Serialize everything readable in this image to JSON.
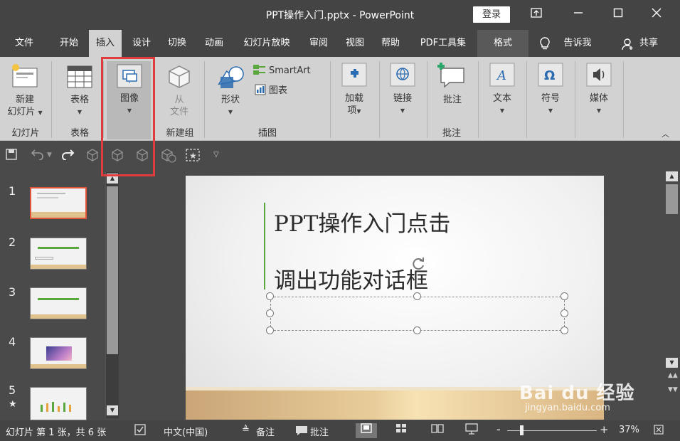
{
  "window": {
    "title": "PPT操作入门.pptx  -  PowerPoint",
    "login_label": "登录",
    "controls": [
      "ribbon-display-icon",
      "minimize-icon",
      "maximize-icon",
      "close-icon"
    ]
  },
  "tabs": [
    {
      "label": "文件"
    },
    {
      "label": "开始"
    },
    {
      "label": "插入",
      "active": true
    },
    {
      "label": "设计"
    },
    {
      "label": "切换"
    },
    {
      "label": "动画"
    },
    {
      "label": "幻灯片放映"
    },
    {
      "label": "审阅"
    },
    {
      "label": "视图"
    },
    {
      "label": "帮助"
    },
    {
      "label": "PDF工具集"
    },
    {
      "label": "格式"
    }
  ],
  "tell_me": "告诉我",
  "share": "共享",
  "ribbon": {
    "new_slide": [
      "新建",
      "幻灯片"
    ],
    "table": "表格",
    "images": "图像",
    "from_file": [
      "从",
      "文件"
    ],
    "shapes": "形状",
    "smartart": "SmartArt",
    "chart": "图表",
    "addins": [
      "加载",
      "项"
    ],
    "links": "链接",
    "comment": "批注",
    "text": "文本",
    "symbols": "符号",
    "media": "媒体",
    "groups": {
      "slides": "幻灯片",
      "tables": "表格",
      "new_group": "新建组",
      "illustrations": "插图",
      "comments": "批注"
    }
  },
  "thumbnails": [
    {
      "num": "1",
      "selected": true
    },
    {
      "num": "2"
    },
    {
      "num": "3"
    },
    {
      "num": "4"
    },
    {
      "num": "5",
      "star": "★"
    }
  ],
  "slide": {
    "title_line1": "PPT操作入门点击",
    "title_line2": "调出功能对话框"
  },
  "status": {
    "slide_info": "幻灯片 第 1 张，共 6 张",
    "language": "中文(中国)",
    "notes": "备注",
    "comments": "批注",
    "zoom_minus": "-",
    "zoom_plus": "+",
    "zoom": "37%"
  },
  "watermark": {
    "brand": "Bai du 经验",
    "url": "jingyan.baidu.com"
  },
  "colors": {
    "highlight": "#e03c3c",
    "accent_green": "#5aa83d",
    "selected_thumb": "#e2553a"
  }
}
